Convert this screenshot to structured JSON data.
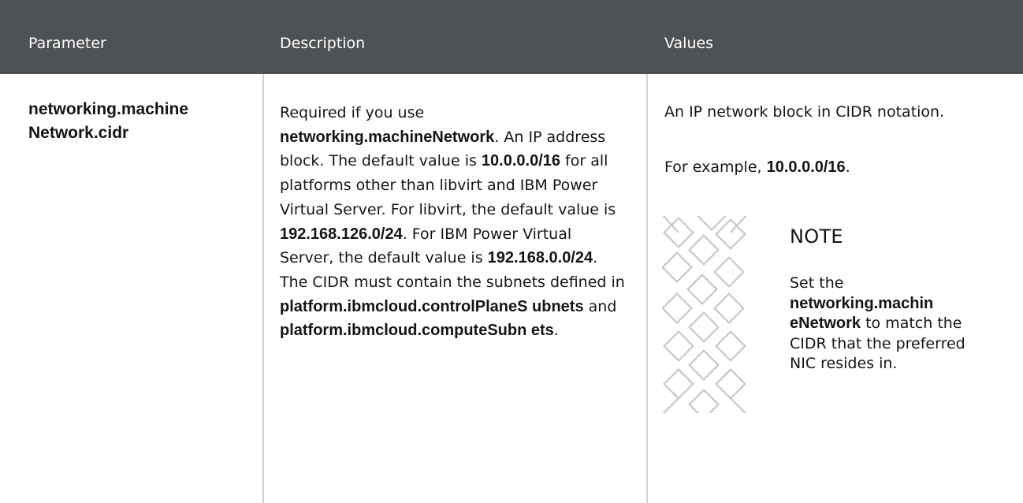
{
  "header": {
    "col_parameter": "Parameter",
    "col_description": "Description",
    "col_values": "Values"
  },
  "row": {
    "parameter": "networking.machine Network.cidr",
    "description": {
      "t1": "Required if you use ",
      "b1": "networking.machineNetwork",
      "t2": ". An IP address block. The default value is ",
      "b2": "10.0.0.0/16",
      "t3": " for all platforms other than libvirt and IBM Power Virtual Server. For libvirt, the default value is ",
      "b3": "192.168.126.0/24",
      "t4": ". For IBM Power Virtual Server, the default value is ",
      "b4": "192.168.0.0/24",
      "t5": ". The CIDR must contain the subnets defined in ",
      "b5": "platform.ibmcloud.controlPlaneS ubnets",
      "t6": " and ",
      "b6": "platform.ibmcloud.computeSubn ets",
      "t7": "."
    },
    "values": {
      "line1": "An IP network block in CIDR notation.",
      "example_prefix": "For example, ",
      "example_value": "10.0.0.0/16",
      "example_suffix": ".",
      "note": {
        "icon": "note-pattern-icon",
        "title": "NOTE",
        "t1": "Set the ",
        "b1": "networking.machin eNetwork",
        "t2": " to match the CIDR that the preferred NIC resides in."
      }
    }
  }
}
